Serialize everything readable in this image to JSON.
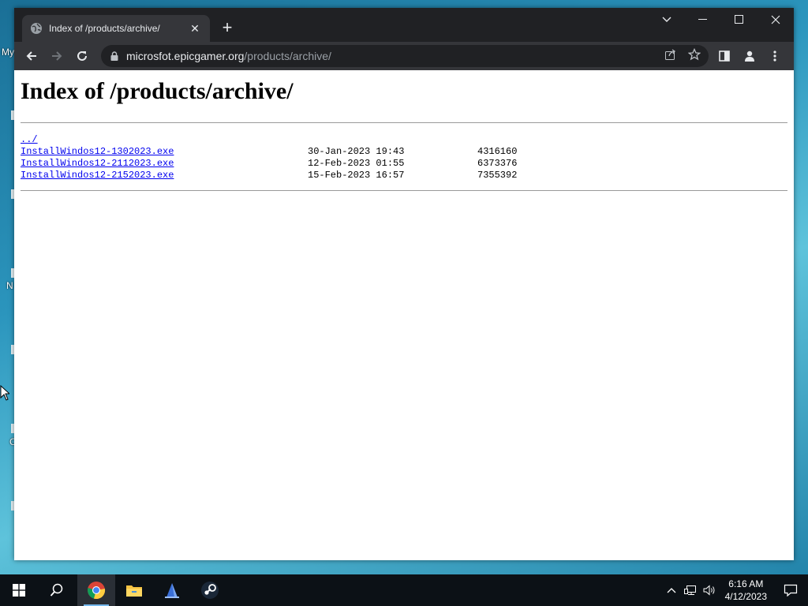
{
  "desktop": {
    "edge_labels": [
      "My",
      "N",
      "C"
    ]
  },
  "browser": {
    "tab": {
      "title": "Index of /products/archive/"
    },
    "omnibox": {
      "domain": "microsfot.epicgamer.org",
      "path": "/products/archive/"
    }
  },
  "page": {
    "heading": "Index of /products/archive/",
    "parent_link": "../",
    "entries": [
      {
        "name": "InstallWindos12-1302023.exe",
        "date": "30-Jan-2023 19:43",
        "size": "4316160"
      },
      {
        "name": "InstallWindos12-2112023.exe",
        "date": "12-Feb-2023 01:55",
        "size": "6373376"
      },
      {
        "name": "InstallWindos12-2152023.exe",
        "date": "15-Feb-2023 16:57",
        "size": "7355392"
      }
    ]
  },
  "taskbar": {
    "time": "6:16 AM",
    "date": "4/12/2023"
  },
  "colors": {
    "link": "#0000ee",
    "chrome_dark": "#202124",
    "chrome_tab": "#35363a",
    "taskbar": "#0c1116"
  }
}
